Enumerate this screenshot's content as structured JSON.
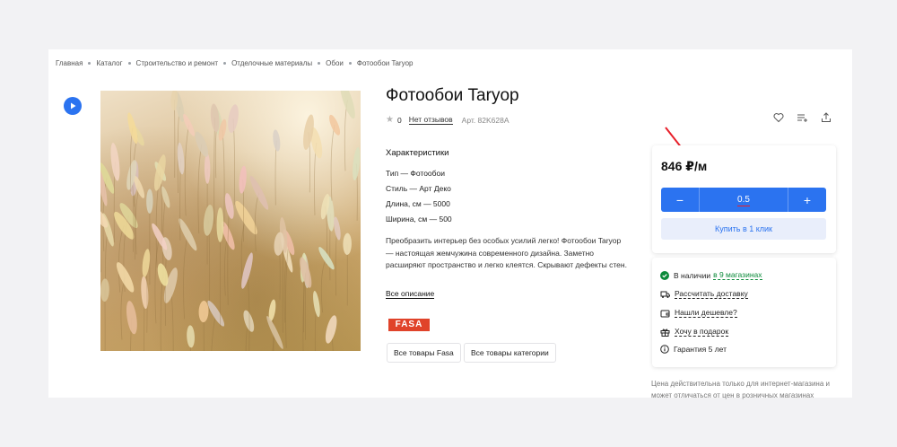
{
  "breadcrumb": [
    "Главная",
    "Каталог",
    "Строительство и ремонт",
    "Отделочные материалы",
    "Обои",
    "Фотообои Taryop"
  ],
  "product": {
    "title": "Фотообои Taryop",
    "rating": "0",
    "reviews": "Нет отзывов",
    "article": "Арт. 82K628A"
  },
  "characteristics": {
    "title": "Характеристики",
    "items": [
      "Тип — Фотообои",
      "Стиль — Арт Деко",
      "Длина, см — 5000",
      "Ширина, см — 500"
    ]
  },
  "description": "Преобразить интерьер без особых усилий легко! Фотообои Taryop — настоящая жемчужина современного дизайна. Заметно расширяют пространство и легко клеятся. Скрывают дефекты стен.",
  "more_link": "Все описание",
  "brand": "FASA",
  "tags": [
    "Все товары Fasa",
    "Все товары категории"
  ],
  "buy": {
    "price": "846 ₽/м",
    "minus": "−",
    "qty": "0.5",
    "plus": "+",
    "one_click": "Купить в 1 клик"
  },
  "info": {
    "stock_prefix": "В наличии",
    "stock_link": "в 9 магазинах",
    "delivery": "Рассчитать доставку",
    "cheaper": "Нашли дешевле?",
    "gift": "Хочу в подарок",
    "warranty": "Гарантия 5 лет"
  },
  "note": "Цена действительна только для интернет-магазина и может отличаться от цен в розничных магазинах",
  "colors": {
    "accent": "#2b73f0",
    "brand": "#e0432a",
    "ok": "#0c8a3a",
    "arrow": "#e8202a"
  }
}
